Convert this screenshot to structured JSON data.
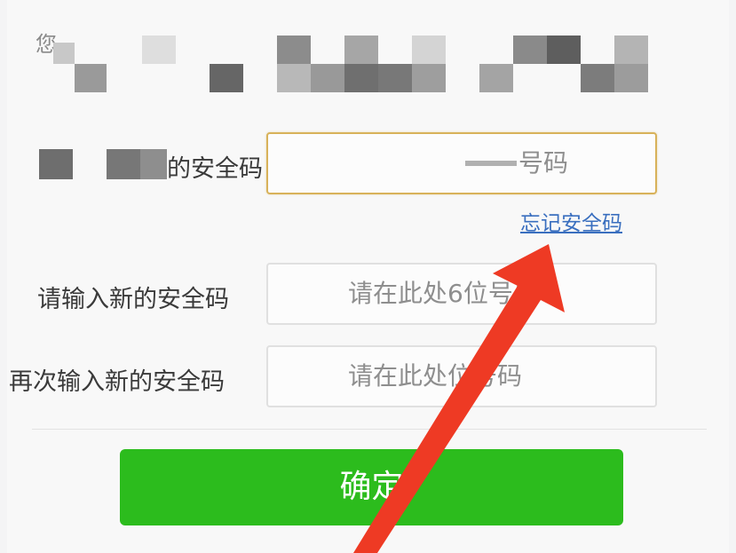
{
  "intro": {
    "first_char": "您"
  },
  "form": {
    "current_code": {
      "label_visible": "的安全码",
      "input_value": "号码"
    },
    "forgot_link": "忘记安全码",
    "new_code": {
      "label": "请输入新的安全码",
      "placeholder": "请在此处6位号码"
    },
    "confirm_code": {
      "label": "再次输入新的安全码",
      "placeholder": "请在此处位号码"
    },
    "submit_label": "确定"
  },
  "colors": {
    "submit_bg": "#2cbc1d",
    "link": "#3a6fbf",
    "focus_border": "#d8b25a",
    "annotation_arrow": "#ee3a24"
  },
  "icons": {
    "annotation": "red-arrow-icon"
  }
}
